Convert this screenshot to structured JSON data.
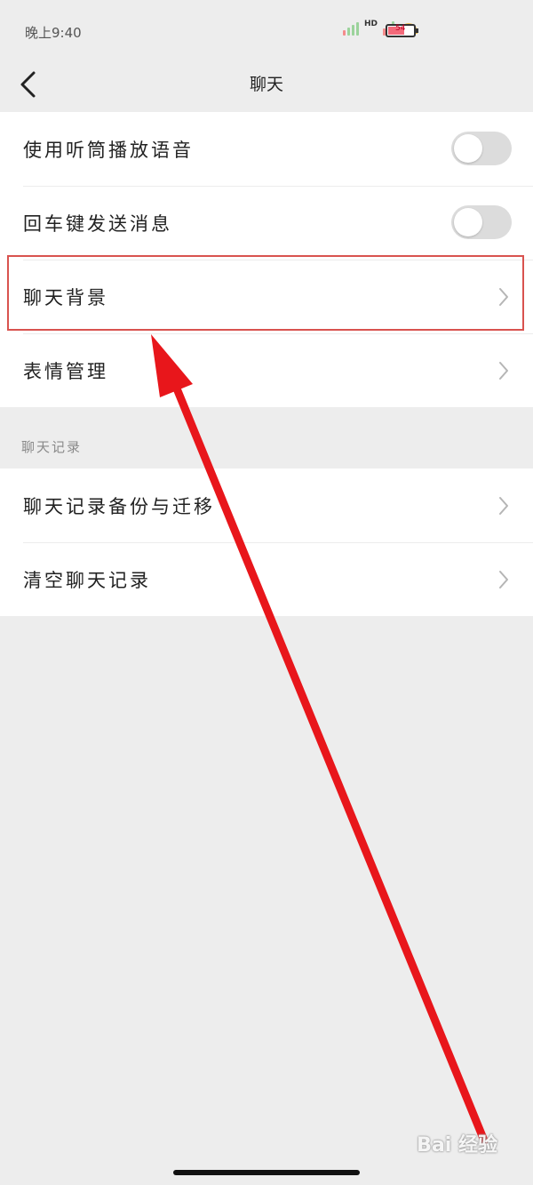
{
  "status_bar": {
    "time": "晚上9:40",
    "network_badge": "HD",
    "battery_level": "54",
    "signal_icon": "signal-icon",
    "wifi_icon": "wifi-icon",
    "battery_icon": "battery-icon"
  },
  "nav": {
    "title": "聊天",
    "back_icon": "chevron-left-icon"
  },
  "settings_group": {
    "items": [
      {
        "label": "使用听筒播放语音",
        "control": "toggle",
        "on": false
      },
      {
        "label": "回车键发送消息",
        "control": "toggle",
        "on": false
      },
      {
        "label": "聊天背景",
        "control": "chevron",
        "highlighted": true
      },
      {
        "label": "表情管理",
        "control": "chevron"
      }
    ]
  },
  "chat_history_group": {
    "header": "聊天记录",
    "items": [
      {
        "label": "聊天记录备份与迁移",
        "control": "chevron"
      },
      {
        "label": "清空聊天记录",
        "control": "chevron"
      }
    ]
  },
  "annotation": {
    "highlight_color": "#d9534f",
    "arrow_color": "#e8161b"
  },
  "watermark": "Bai 经验",
  "colors": {
    "background": "#ededed",
    "row_background": "#ffffff",
    "toggle_off": "#dcdcdc",
    "chevron": "#b5b5b5"
  }
}
